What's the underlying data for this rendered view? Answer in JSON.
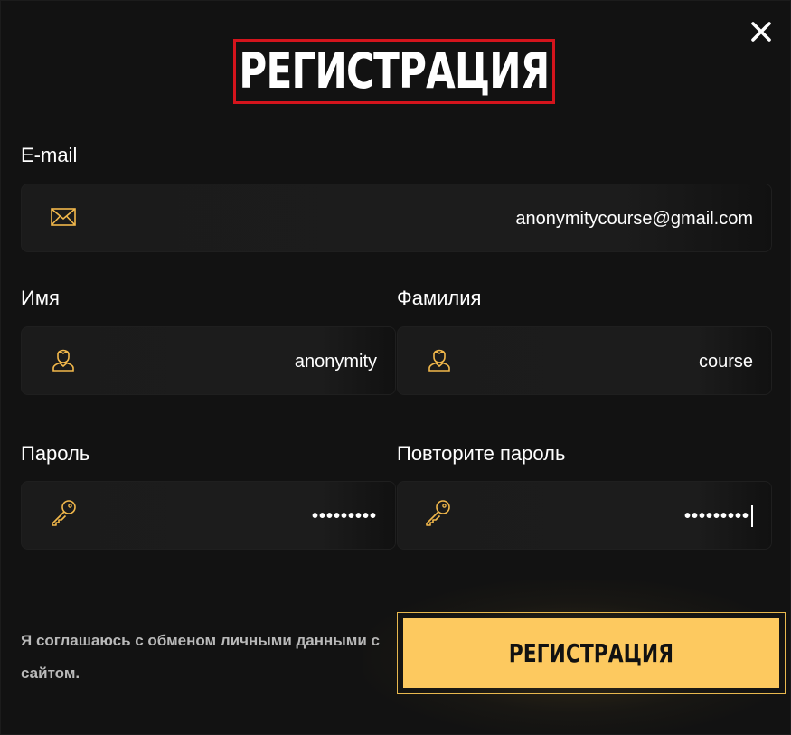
{
  "modal": {
    "title": "РЕГИСТРАЦИЯ",
    "close_icon": "close-icon"
  },
  "email": {
    "label": "E-mail",
    "value": "anonymitycourse@gmail.com",
    "icon": "envelope-icon"
  },
  "first_name": {
    "label": "Имя",
    "value": "anonymity",
    "icon": "user-icon"
  },
  "last_name": {
    "label": "Фамилия",
    "value": "course",
    "icon": "user-icon"
  },
  "password": {
    "label": "Пароль",
    "value": "•••••••••",
    "icon": "key-icon"
  },
  "password_repeat": {
    "label": "Повторите пароль",
    "value": "•••••••••",
    "icon": "key-icon"
  },
  "agreement": {
    "text": "Я соглашаюсь с обменом личными данными с сайтом."
  },
  "submit": {
    "label": "РЕГИСТРАЦИЯ"
  },
  "colors": {
    "background": "#121212",
    "field": "#1b1b1b",
    "accent": "#fdc95f",
    "icon": "#f2b84b",
    "title_highlight": "#d4141c",
    "text": "#ffffff",
    "muted": "#b9b9b9"
  }
}
